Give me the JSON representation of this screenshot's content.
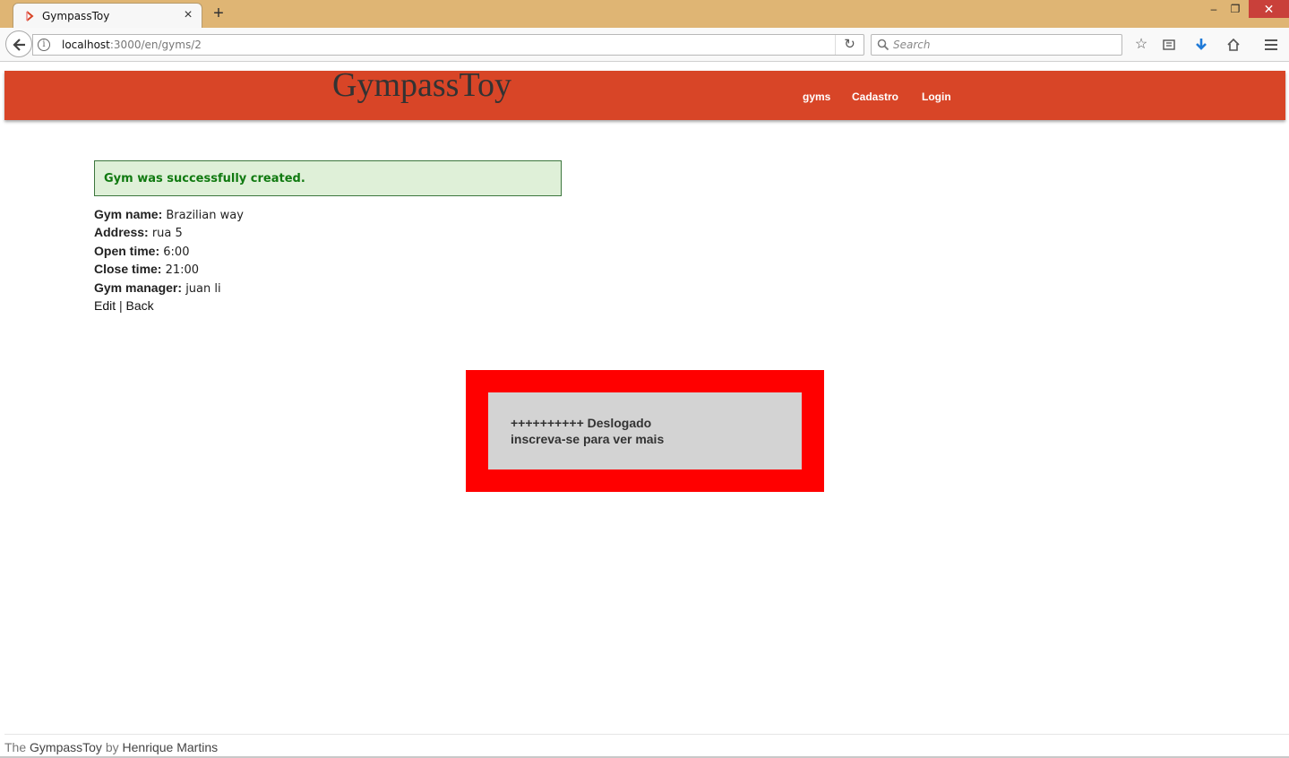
{
  "browser": {
    "tab_title": "GympassToy",
    "tab_close": "×",
    "new_tab": "+",
    "url_host": "localhost",
    "url_path": ":3000/en/gyms/2",
    "search_placeholder": "Search",
    "window_minimize": "–",
    "window_restore": "❐",
    "window_close": "✕"
  },
  "site": {
    "title": "GympassToy",
    "header_color": "#d84527",
    "nav": [
      "gyms",
      "Cadastro",
      "Login"
    ]
  },
  "notice": {
    "text": "Gym was successfully created.",
    "color": "#117a11",
    "background": "#dff0d8"
  },
  "gym": {
    "fields": [
      {
        "label": "Gym name:",
        "value": "Brazilian way"
      },
      {
        "label": "Address:",
        "value": "rua 5"
      },
      {
        "label": "Open time:",
        "value": "6:00"
      },
      {
        "label": "Close time:",
        "value": "21:00"
      },
      {
        "label": "Gym manager:",
        "value": "juan li"
      }
    ],
    "edit_link": "Edit",
    "separator": "|",
    "back_link": "Back"
  },
  "promo": {
    "line1": "++++++++++ Deslogado",
    "line2": "inscreva-se para ver mais",
    "border_color": "#ff0000",
    "fill_color": "#d3d3d3"
  },
  "footer": {
    "prefix": "The",
    "app": "GympassToy",
    "by": "by",
    "author": "Henrique Martins"
  }
}
